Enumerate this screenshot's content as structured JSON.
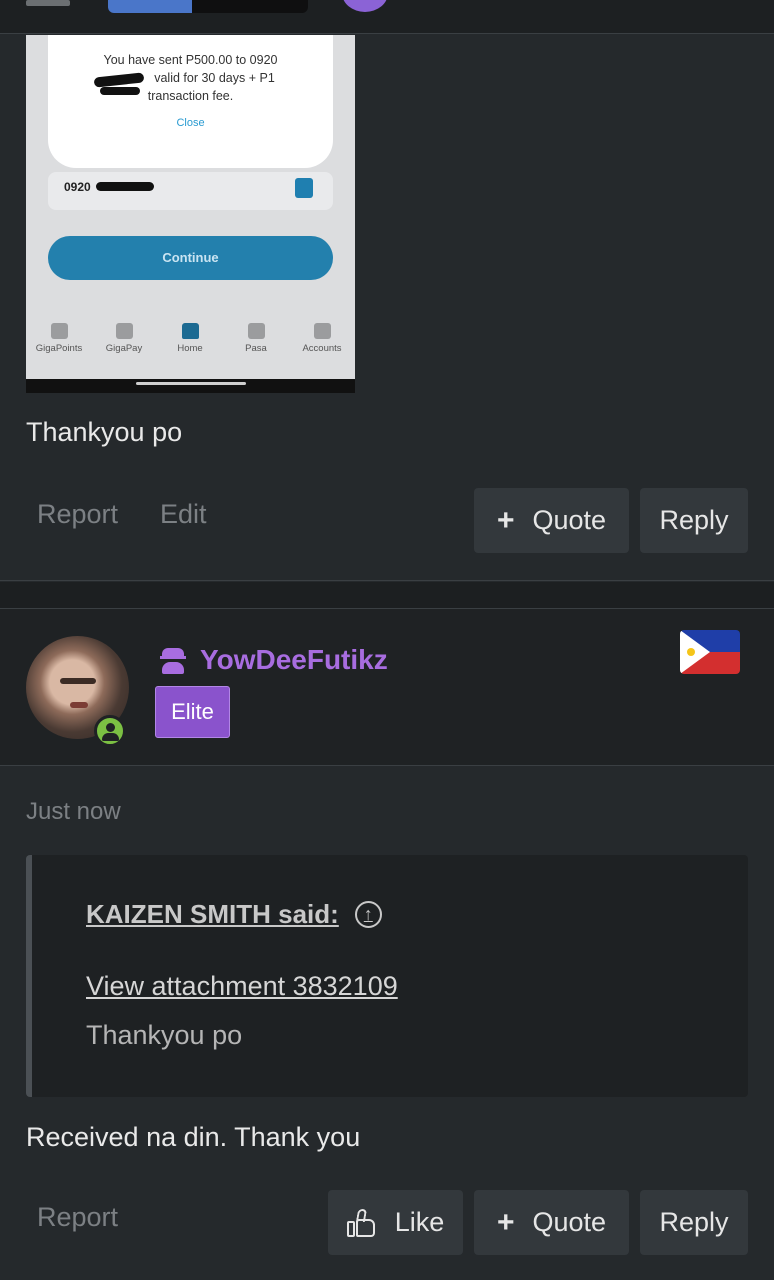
{
  "colors": {
    "background": "#25292c",
    "username": "#a86de0",
    "badge": "#8a53cc",
    "online": "#7bc043",
    "button": "#33383c"
  },
  "post1": {
    "attachment": {
      "modal_line1": "You have sent P500.00 to 0920",
      "modal_line2": "valid for 30 days + P1",
      "modal_line3": "transaction fee.",
      "modal_close": "Close",
      "field_number": "0920",
      "continue_label": "Continue",
      "tabs": [
        {
          "label": "GigaPoints",
          "icon": "gift-icon"
        },
        {
          "label": "GigaPay",
          "icon": "wallet-icon"
        },
        {
          "label": "Home",
          "icon": "home-icon"
        },
        {
          "label": "Pasa",
          "icon": "share-icon"
        },
        {
          "label": "Accounts",
          "icon": "card-icon"
        }
      ]
    },
    "message": "Thankyou po",
    "actions": {
      "report": "Report",
      "edit": "Edit",
      "quote": "Quote",
      "reply": "Reply"
    }
  },
  "post2": {
    "username": "YowDeeFutikz",
    "badge": "Elite",
    "flag": "philippines-flag",
    "time": "Just now",
    "quote": {
      "author": "KAIZEN SMITH said:",
      "attachment_link": "View attachment 3832109",
      "text": "Thankyou po"
    },
    "message": "Received na din. Thank you",
    "actions": {
      "report": "Report",
      "like": "Like",
      "quote": "Quote",
      "reply": "Reply"
    }
  }
}
